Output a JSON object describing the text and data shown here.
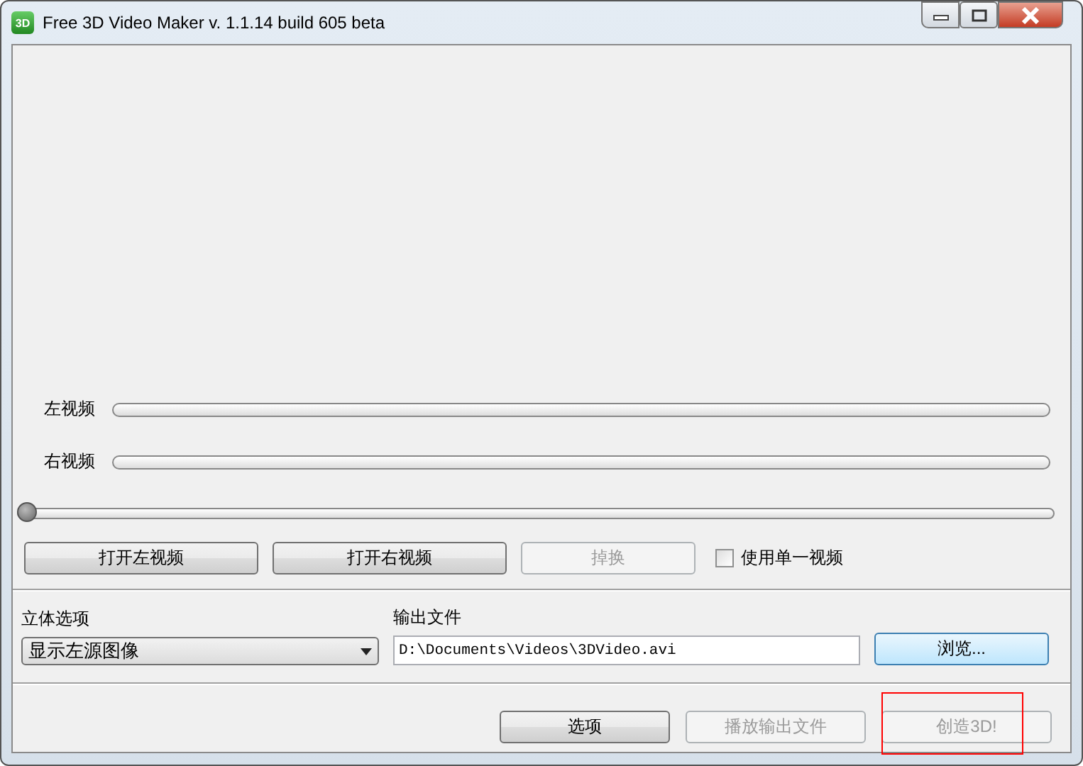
{
  "window": {
    "title": "Free 3D Video Maker  v. 1.1.14 build 605 beta",
    "app_icon_text": "3D"
  },
  "tracks": [
    {
      "label": "左视频",
      "level": 0
    },
    {
      "label": "右视频",
      "level": 0
    }
  ],
  "seek": {
    "level": 0
  },
  "video_buttons": [
    {
      "label": "打开左视频",
      "disabled": false
    },
    {
      "label": "打开右视频",
      "disabled": false
    },
    {
      "label": "掉换",
      "disabled": true
    }
  ],
  "single_video": {
    "label": "使用单一视频",
    "checked": false
  },
  "stereo": {
    "label": "立体选项",
    "value": "显示左源图像"
  },
  "output": {
    "label": "输出文件",
    "value": "D:\\Documents\\Videos\\3DVideo.avi",
    "browse": "浏览..."
  },
  "bottom_buttons": [
    {
      "label": "选项",
      "disabled": false,
      "highlighted": false
    },
    {
      "label": "播放输出文件",
      "disabled": true,
      "highlighted": false
    },
    {
      "label": "创造3D!",
      "disabled": true,
      "highlighted": true
    }
  ]
}
